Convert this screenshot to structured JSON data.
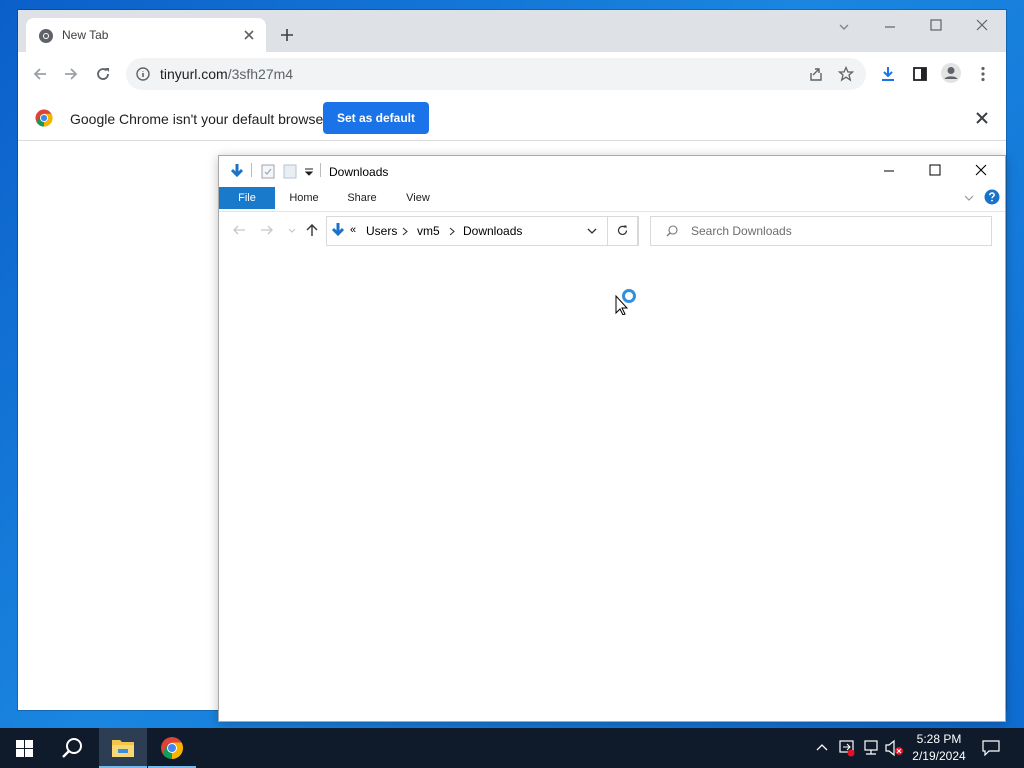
{
  "browser": {
    "tab_title": "New Tab",
    "url_host": "tinyurl.com",
    "url_path": "/3sfh27m4",
    "infobar_text": "Google Chrome isn't your default browser",
    "set_default_label": "Set as default"
  },
  "explorer": {
    "title": "Downloads",
    "ribbon_tabs": [
      "File",
      "Home",
      "Share",
      "View"
    ],
    "breadcrumb": [
      "Users",
      "vm5",
      "Downloads"
    ],
    "breadcrumb_prefix": "«",
    "search_placeholder": "Search Downloads"
  },
  "taskbar": {
    "time": "5:28 PM",
    "date": "2/19/2024"
  },
  "colors": {
    "chrome_blue": "#1a73e8",
    "file_tab": "#1979ca",
    "desktop": "#0e6bd1",
    "taskbar": "#0f1a2b"
  }
}
